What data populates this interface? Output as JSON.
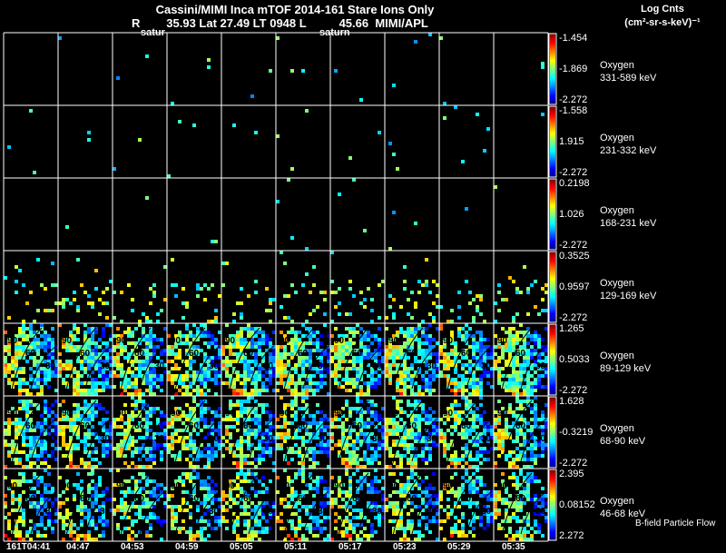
{
  "header": {
    "title_line1": "Cassini/MIMI Inca mTOF  2014-161    Stare    Ions Only",
    "title_line2": "R        35.93 Lat 27.49 LT 0948 L          45.66  MIMI/APL",
    "overlay_labels": [
      "satur",
      "saturn"
    ],
    "units_line1": "Log Cnts",
    "units_line2": "(cm²-sr-s-keV)⁻¹"
  },
  "chart_data": {
    "type": "heatmap",
    "title": "Cassini/MIMI Inca mTOF 2014-161 Stare Ions Only",
    "colormap": "jet",
    "colorbar_label": "Log Cnts (cm²-sr-s-keV)⁻¹",
    "times": [
      "161T04:41",
      "04:47",
      "04:53",
      "04:59",
      "05:05",
      "05:11",
      "05:17",
      "05:23",
      "05:29",
      "05:35"
    ],
    "contour_labels": [
      "90",
      "60",
      "30"
    ],
    "channels": [
      {
        "species": "Oxygen",
        "energy": "331-589 keV",
        "max": "-1.454",
        "mid": "-1.869",
        "min": "-2.272",
        "coverage": 0.005
      },
      {
        "species": "Oxygen",
        "energy": "231-332 keV",
        "max": "-1.558",
        "mid": "1.915",
        "min": "-2.272",
        "coverage": 0.006
      },
      {
        "species": "Oxygen",
        "energy": "168-231 keV",
        "max": "0.2198",
        "mid": "1.026",
        "min": "-2.272",
        "coverage": 0.006
      },
      {
        "species": "Oxygen",
        "energy": "129-169 keV",
        "max": "0.3525",
        "mid": "0.9597",
        "min": "-2.272",
        "coverage": 0.12
      },
      {
        "species": "Oxygen",
        "energy": "89-129 keV",
        "max": "1.265",
        "mid": "0.5033",
        "min": "-2.272",
        "coverage": 0.7
      },
      {
        "species": "Oxygen",
        "energy": "68-90 keV",
        "max": "1.628",
        "mid": "-0.3219",
        "min": "-2.272",
        "coverage": 0.6
      },
      {
        "species": "Oxygen",
        "energy": "46-68 keV",
        "max": "2.395",
        "mid": "0.08152",
        "min": "2.272",
        "coverage": 0.5
      }
    ],
    "footer_label": "B-field Particle Flow"
  }
}
